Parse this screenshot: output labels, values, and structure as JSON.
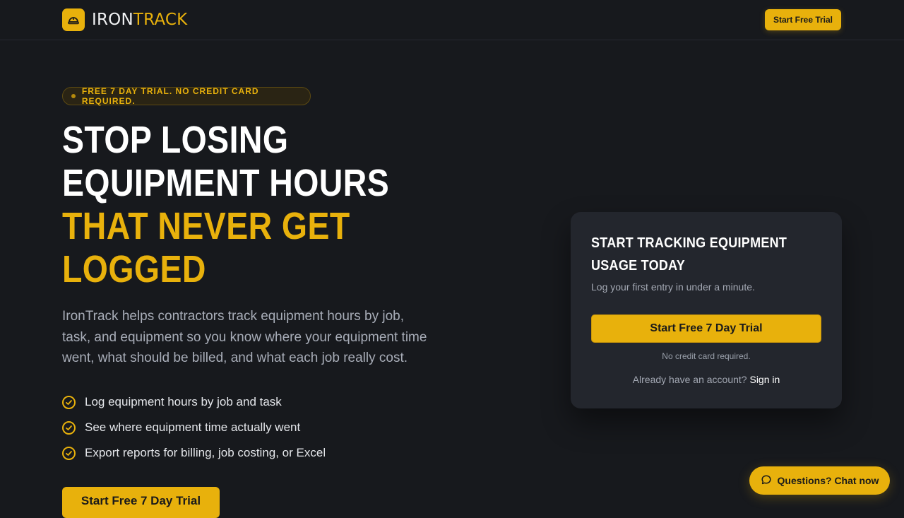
{
  "header": {
    "brand_part1": "IRON",
    "brand_part2": "TRACK",
    "cta_label": "Start Free Trial"
  },
  "hero": {
    "badge": "FREE 7 DAY TRIAL. NO CREDIT CARD REQUIRED.",
    "headline_line1": "STOP LOSING",
    "headline_line2": "EQUIPMENT HOURS",
    "headline_line3": "THAT NEVER GET",
    "headline_line4": "LOGGED",
    "lead": "IronTrack helps contractors track equipment hours by job, task, and equipment so you know where your equipment time went, what should be billed, and what each job really cost.",
    "features": [
      "Log equipment hours by job and task",
      "See where equipment time actually went",
      "Export reports for billing, job costing, or Excel"
    ],
    "cta_label": "Start Free 7 Day Trial"
  },
  "card": {
    "title": "START TRACKING EQUIPMENT USAGE TODAY",
    "subtitle": "Log your first entry in under a minute.",
    "cta_label": "Start Free 7 Day Trial",
    "note": "No credit card required.",
    "signin_prompt": "Already have an account?",
    "signin_link": "Sign in"
  },
  "chat": {
    "label": "Questions? Chat now",
    "icon": "chat-bubble-icon"
  },
  "colors": {
    "background": "#17191d",
    "accent": "#e8b10c",
    "card": "#23262d"
  }
}
